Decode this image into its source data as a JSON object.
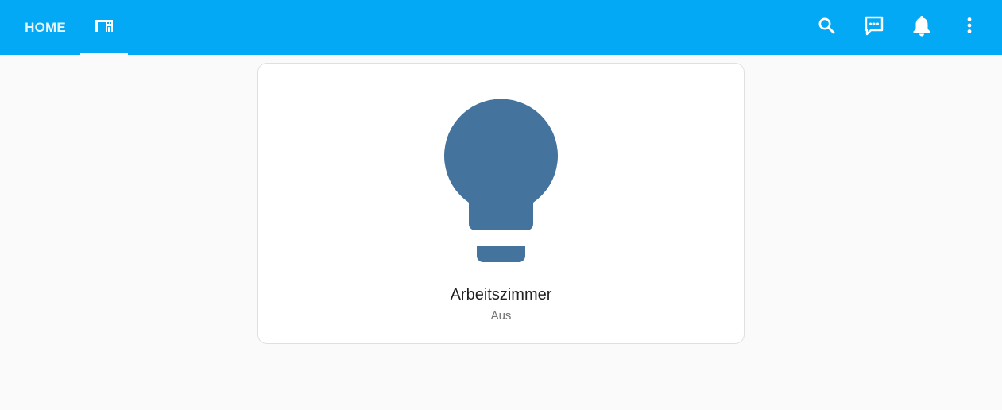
{
  "header": {
    "tabs": [
      {
        "label": "HOME",
        "icon": null
      },
      {
        "label": "",
        "icon": "floor-plan-icon",
        "active": true
      }
    ],
    "actions": [
      {
        "icon": "search-icon"
      },
      {
        "icon": "assist-chat-icon"
      },
      {
        "icon": "bell-icon"
      },
      {
        "icon": "more-vertical-icon"
      }
    ]
  },
  "card": {
    "name": "Arbeitszimmer",
    "state": "Aus",
    "icon": "lightbulb-icon",
    "icon_color": "#44739e"
  },
  "colors": {
    "header_bg": "#03a9f4",
    "page_bg": "#fafafa"
  }
}
